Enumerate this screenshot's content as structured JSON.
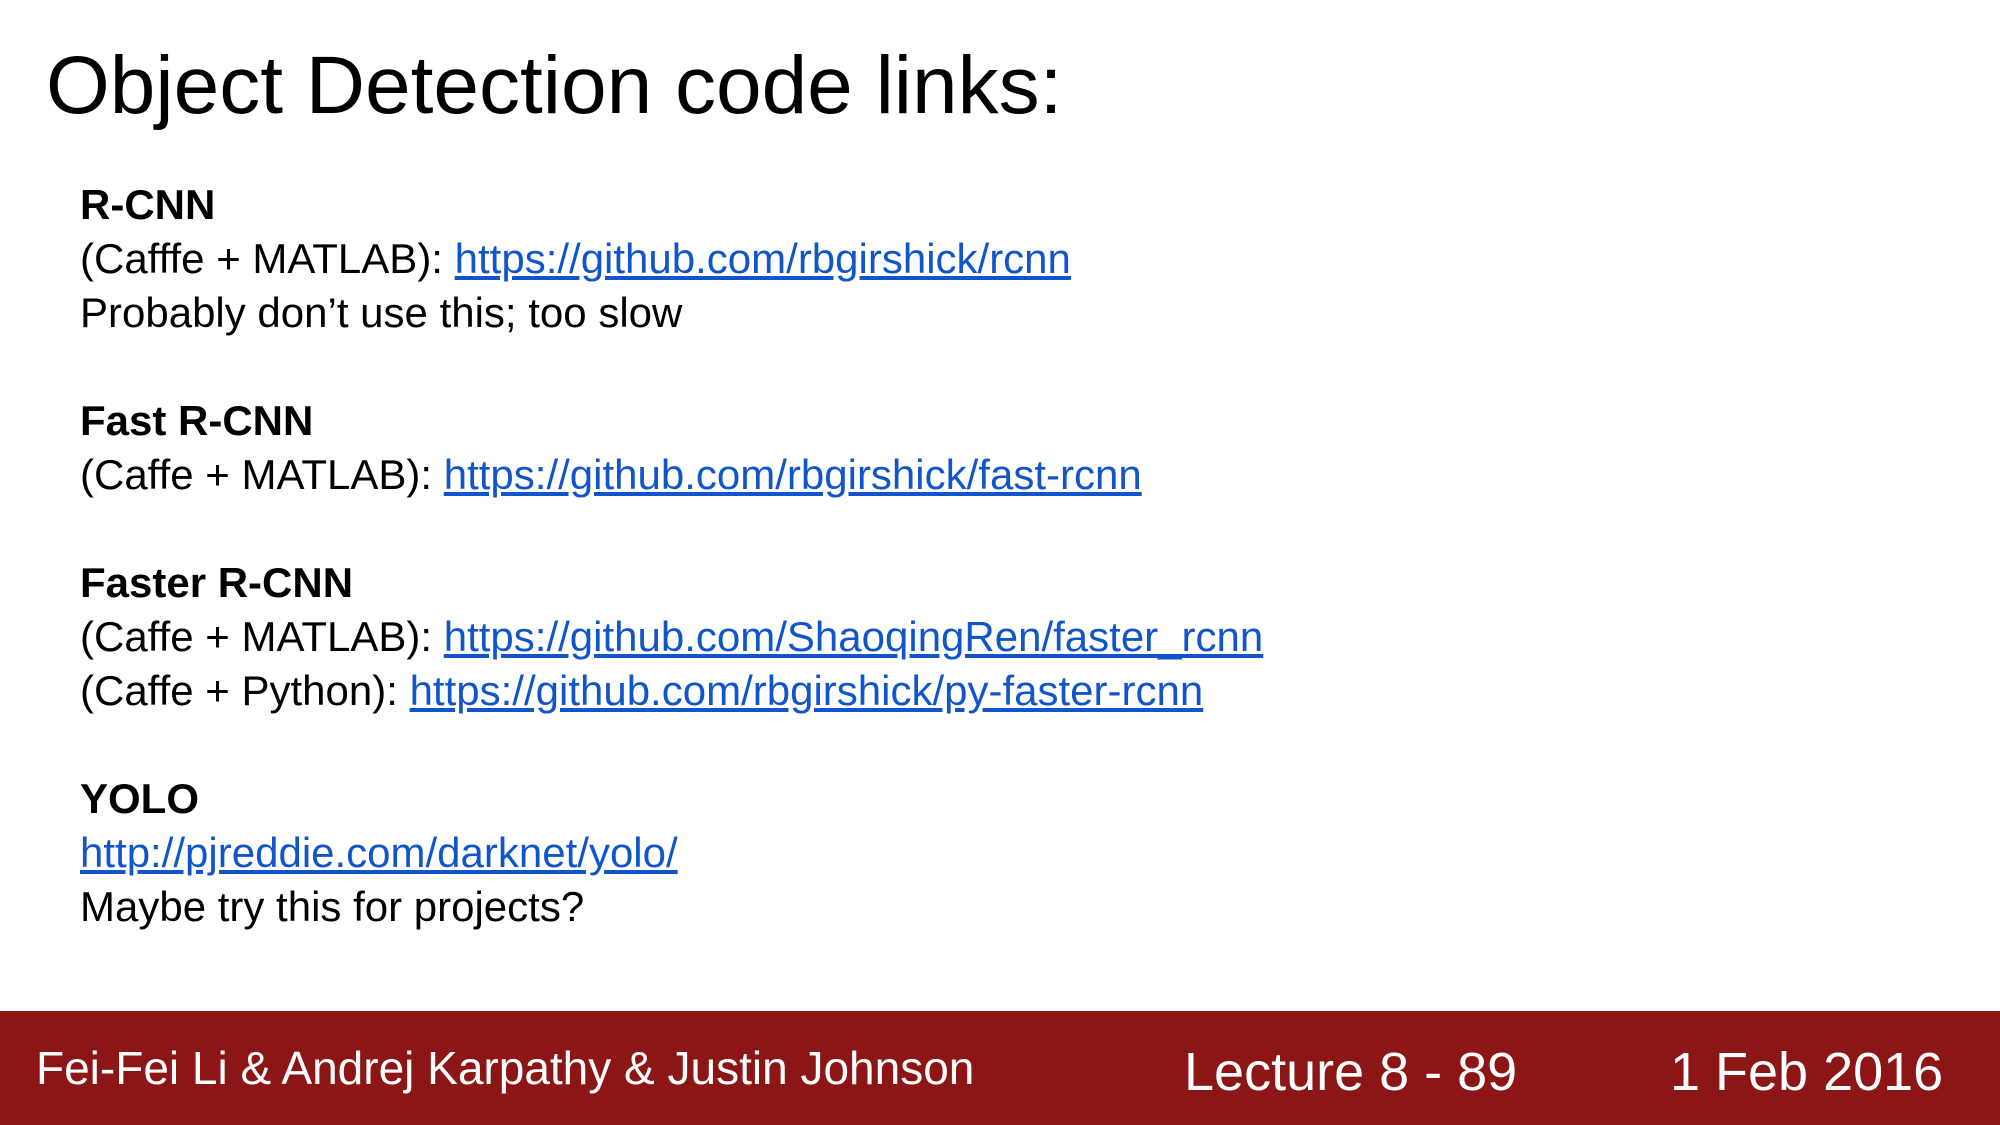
{
  "title": "Object Detection code links:",
  "sections": [
    {
      "heading": "R-CNN",
      "lines": [
        {
          "prefix": "(Cafffe + MATLAB): ",
          "link": "https://github.com/rbgirshick/rcnn"
        },
        {
          "text": "Probably don’t use this; too slow"
        }
      ]
    },
    {
      "heading": "Fast R-CNN",
      "lines": [
        {
          "prefix": "(Caffe + MATLAB): ",
          "link": "https://github.com/rbgirshick/fast-rcnn"
        }
      ]
    },
    {
      "heading": "Faster R-CNN",
      "lines": [
        {
          "prefix": "(Caffe + MATLAB): ",
          "link": "https://github.com/ShaoqingRen/faster_rcnn"
        },
        {
          "prefix": "(Caffe + Python): ",
          "link": "https://github.com/rbgirshick/py-faster-rcnn"
        }
      ]
    },
    {
      "heading": "YOLO",
      "lines": [
        {
          "link": "http://pjreddie.com/darknet/yolo/"
        },
        {
          "text": "Maybe try this for projects?"
        }
      ]
    }
  ],
  "footer": {
    "authors": "Fei-Fei Li & Andrej Karpathy & Justin Johnson",
    "lecture": "Lecture 8 - 89",
    "date": "1 Feb 2016"
  },
  "colors": {
    "footer_bg": "#8c1515",
    "link": "#1155cc"
  }
}
